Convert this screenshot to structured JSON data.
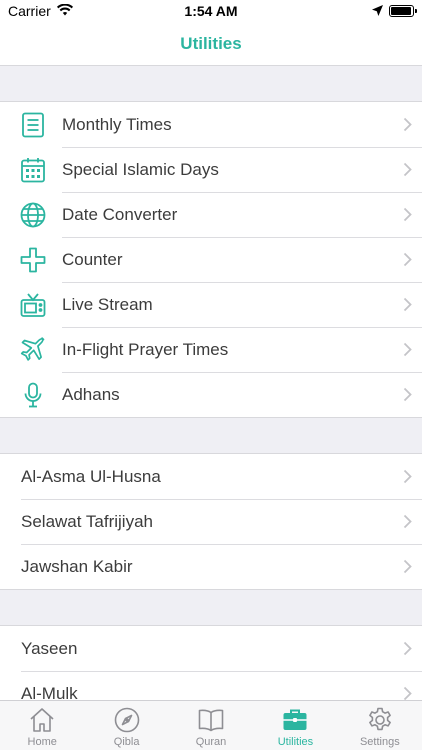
{
  "status_bar": {
    "carrier": "Carrier",
    "time": "1:54 AM",
    "battery_level": 0.95
  },
  "nav": {
    "title": "Utilities"
  },
  "colors": {
    "accent": "#2bb5a0",
    "inactive": "#8e8e93"
  },
  "sections": [
    {
      "items": [
        {
          "label": "Monthly Times",
          "icon": "list-document-icon"
        },
        {
          "label": "Special Islamic Days",
          "icon": "calendar-icon"
        },
        {
          "label": "Date Converter",
          "icon": "globe-icon"
        },
        {
          "label": "Counter",
          "icon": "plus-icon"
        },
        {
          "label": "Live Stream",
          "icon": "tv-icon"
        },
        {
          "label": "In-Flight Prayer Times",
          "icon": "airplane-icon"
        },
        {
          "label": "Adhans",
          "icon": "microphone-icon"
        }
      ]
    },
    {
      "items": [
        {
          "label": "Al-Asma Ul-Husna"
        },
        {
          "label": "Selawat Tafrijiyah"
        },
        {
          "label": "Jawshan Kabir"
        }
      ]
    },
    {
      "items": [
        {
          "label": "Yaseen"
        },
        {
          "label": "Al-Mulk"
        }
      ]
    }
  ],
  "tabs": [
    {
      "label": "Home",
      "icon": "home-icon"
    },
    {
      "label": "Qibla",
      "icon": "compass-icon"
    },
    {
      "label": "Quran",
      "icon": "book-icon"
    },
    {
      "label": "Utilities",
      "icon": "briefcase-icon",
      "active": true
    },
    {
      "label": "Settings",
      "icon": "gear-icon"
    }
  ]
}
